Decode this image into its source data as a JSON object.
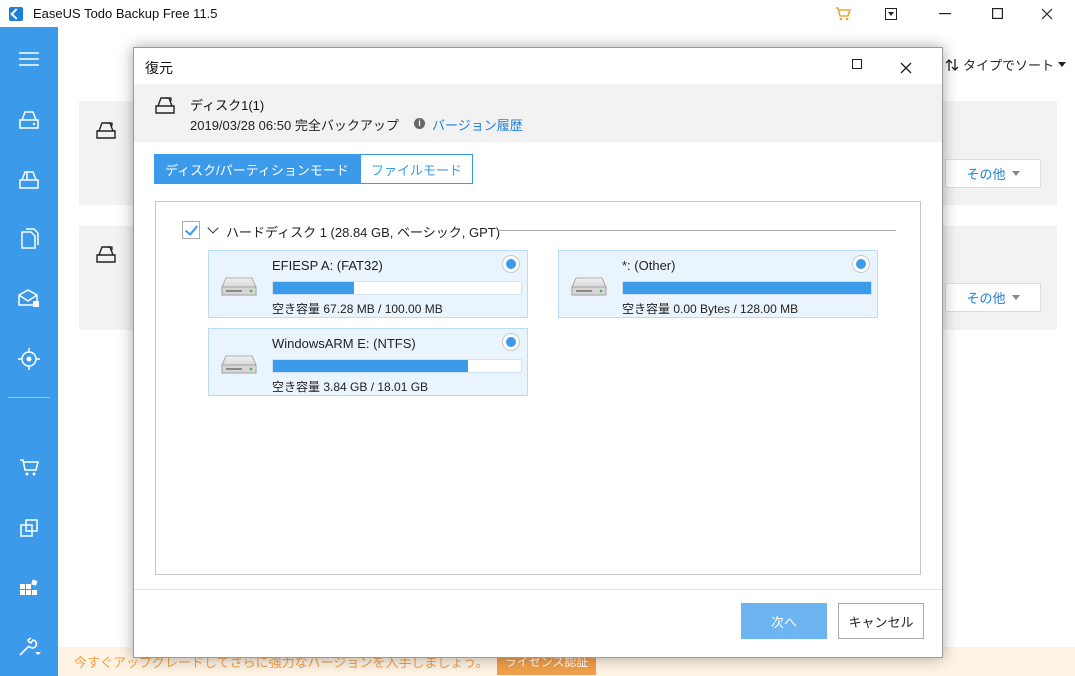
{
  "app": {
    "title": "EaseUS Todo Backup Free 11.5",
    "accent_color": "#3b9ae9",
    "window_controls": [
      "cart-icon",
      "menu-dropdown-icon",
      "minimize-icon",
      "maximize-icon",
      "close-icon"
    ]
  },
  "sidebar": {
    "items": [
      {
        "icon": "menu-icon"
      },
      {
        "icon": "disk-backup-icon"
      },
      {
        "icon": "partition-backup-icon"
      },
      {
        "icon": "file-backup-icon"
      },
      {
        "icon": "mail-backup-icon"
      },
      {
        "icon": "smart-backup-icon"
      },
      {
        "icon": "cart-icon"
      },
      {
        "icon": "clone-icon"
      },
      {
        "icon": "apps-icon"
      },
      {
        "icon": "tools-icon"
      }
    ]
  },
  "background": {
    "sort_label": "タイプでソート",
    "more_label_1": "その他",
    "more_label_2": "その他"
  },
  "banner": {
    "text": "今すぐアップグレードしてさらに強力なバージョンを入手しましょう。",
    "button": "ライセンス認証"
  },
  "dialog": {
    "title": "復元",
    "backup": {
      "name": "ディスク1(1)",
      "date_line": "2019/03/28 06:50 完全バックアップ",
      "history_link": "バージョン履歴"
    },
    "tabs": [
      {
        "label": "ディスク/パーティションモード",
        "active": true
      },
      {
        "label": "ファイルモード",
        "active": false
      }
    ],
    "disk": {
      "label": "ハードディスク 1 (28.84 GB, ベーシック, GPT)",
      "checked": true
    },
    "partitions": [
      {
        "name": "EFIESP A: (FAT32)",
        "free": "空き容量 67.28 MB / 100.00 MB",
        "used_pct": 32.7,
        "selected": true
      },
      {
        "name": "*: (Other)",
        "free": "空き容量 0.00 Bytes / 128.00 MB",
        "used_pct": 100,
        "selected": true
      },
      {
        "name": "WindowsARM E: (NTFS)",
        "free": "空き容量 3.84 GB / 18.01 GB",
        "used_pct": 78.7,
        "selected": true
      }
    ],
    "buttons": {
      "next": "次へ",
      "cancel": "キャンセル"
    }
  }
}
